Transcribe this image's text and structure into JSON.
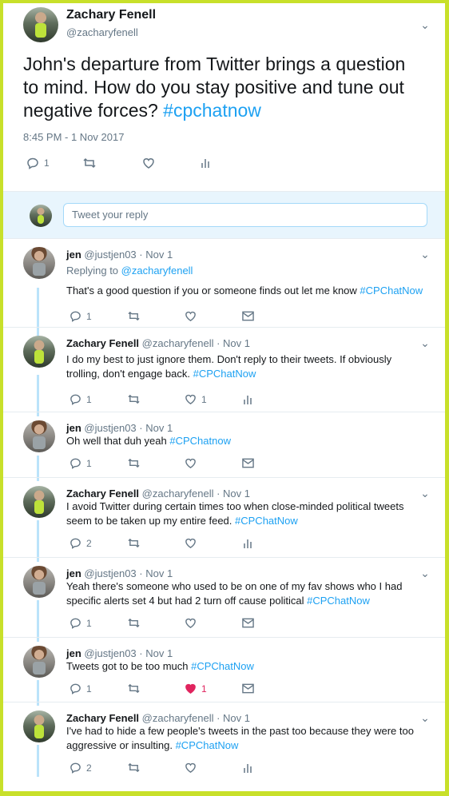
{
  "main_tweet": {
    "name": "Zachary Fenell",
    "handle": "@zacharyfenell",
    "text_prefix": "John's departure from Twitter brings a question to mind. How do you stay positive and tune out negative forces? ",
    "hashtag": "#cpchatnow",
    "timestamp": "8:45 PM - 1 Nov 2017",
    "reply_count": "1"
  },
  "reply_box": {
    "placeholder": "Tweet your reply"
  },
  "replies": [
    {
      "name": "jen",
      "handle": "@justjen03",
      "date": "· Nov 1",
      "replying_label": "Replying to ",
      "replying_to": "@zacharyfenell",
      "text": "That's a good question if you or someone finds out let me know ",
      "hashtag": "#CPChatNow",
      "reply_count": "1",
      "like_count": "",
      "liked": false,
      "last_action": "mail"
    },
    {
      "name": "Zachary Fenell",
      "handle": "@zacharyfenell",
      "date": "· Nov 1",
      "text": "I do my best to just ignore them. Don't reply to their tweets. If obviously trolling, don't engage back. ",
      "hashtag": "#CPChatNow",
      "reply_count": "1",
      "like_count": "1",
      "liked": false,
      "last_action": "analytics"
    },
    {
      "name": "jen",
      "handle": "@justjen03",
      "date": "· Nov 1",
      "text": "Oh well that duh yeah ",
      "hashtag": "#CPChatnow",
      "reply_count": "1",
      "like_count": "",
      "liked": false,
      "last_action": "mail"
    },
    {
      "name": "Zachary Fenell",
      "handle": "@zacharyfenell",
      "date": "· Nov 1",
      "text": "I avoid Twitter during certain times too when close-minded political tweets seem to be taken up my entire feed. ",
      "hashtag": "#CPChatNow",
      "reply_count": "2",
      "like_count": "",
      "liked": false,
      "last_action": "analytics"
    },
    {
      "name": "jen",
      "handle": "@justjen03",
      "date": "· Nov 1",
      "text": "Yeah there's someone who used to be on one of my fav shows who I had specific alerts set 4 but had 2 turn off cause political ",
      "hashtag": "#CPChatNow",
      "reply_count": "1",
      "like_count": "",
      "liked": false,
      "last_action": "mail"
    },
    {
      "name": "jen",
      "handle": "@justjen03",
      "date": "· Nov 1",
      "text": "Tweets got to be too much ",
      "hashtag": "#CPChatNow",
      "reply_count": "1",
      "like_count": "1",
      "liked": true,
      "last_action": "mail"
    },
    {
      "name": "Zachary Fenell",
      "handle": "@zacharyfenell",
      "date": "· Nov 1",
      "text": "I've had to hide a few people's tweets in the past too because they were too aggressive or insulting. ",
      "hashtag": "#CPChatNow",
      "reply_count": "2",
      "like_count": "",
      "liked": false,
      "last_action": "analytics"
    }
  ]
}
